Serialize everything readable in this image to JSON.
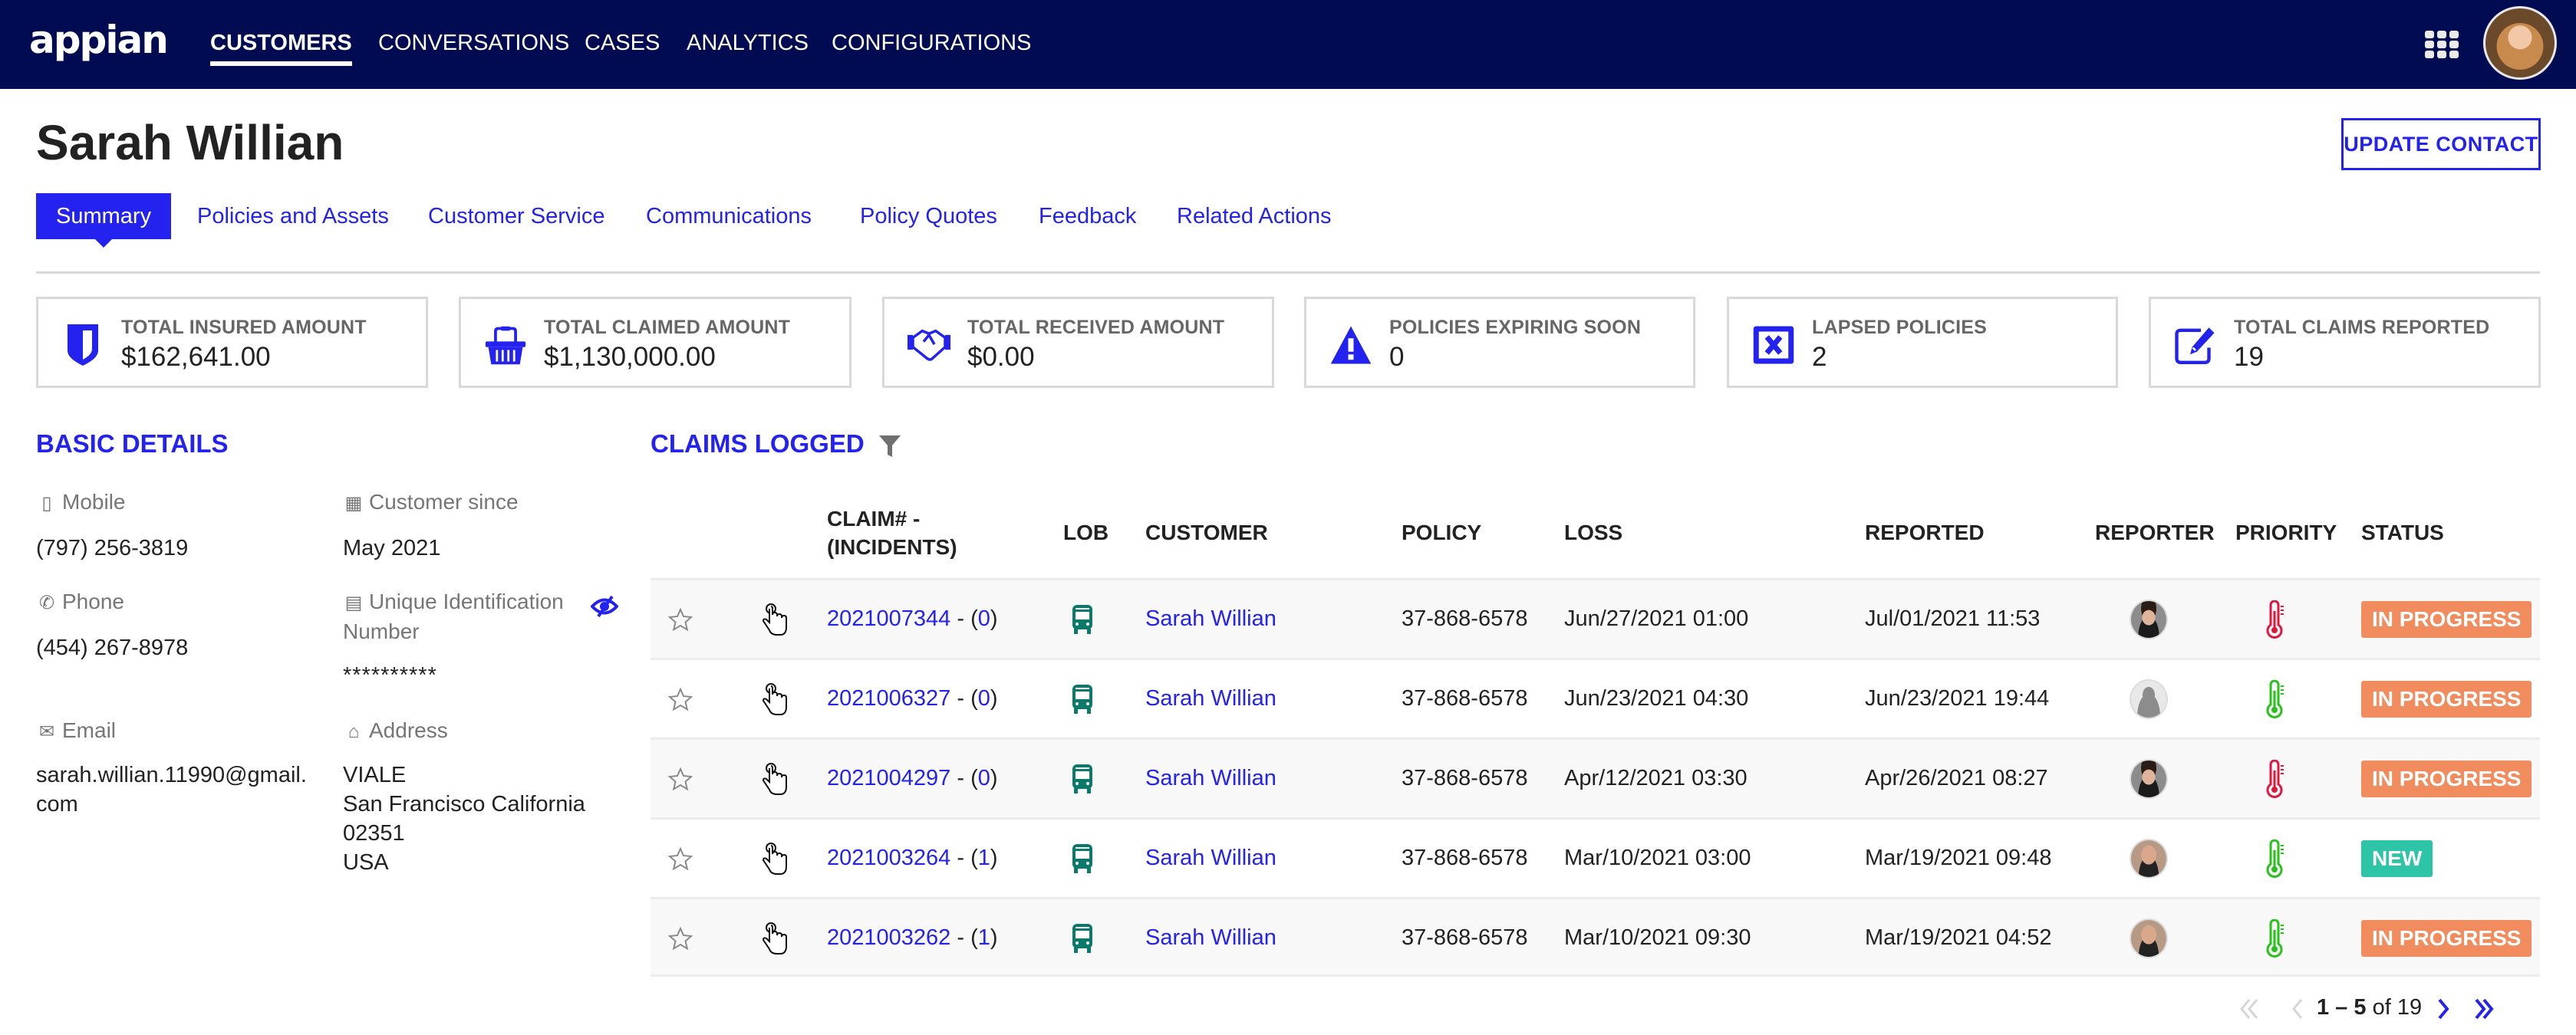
{
  "app": {
    "logo": "appian",
    "nav": [
      {
        "label": "CUSTOMERS",
        "active": true
      },
      {
        "label": "CONVERSATIONS",
        "active": false
      },
      {
        "label": "CASES",
        "active": false
      },
      {
        "label": "ANALYTICS",
        "active": false
      },
      {
        "label": "CONFIGURATIONS",
        "active": false
      }
    ],
    "apps_icon": "grid-icon",
    "user_avatar": "user-avatar"
  },
  "page": {
    "title": "Sarah Willian",
    "update_button": "UPDATE CONTACT",
    "tabs": [
      {
        "label": "Summary",
        "active": true
      },
      {
        "label": "Policies and Assets",
        "active": false
      },
      {
        "label": "Customer Service",
        "active": false
      },
      {
        "label": "Communications",
        "active": false
      },
      {
        "label": "Policy Quotes",
        "active": false
      },
      {
        "label": "Feedback",
        "active": false
      },
      {
        "label": "Related Actions",
        "active": false
      }
    ]
  },
  "kpis": [
    {
      "icon": "shield-icon",
      "label": "TOTAL INSURED AMOUNT",
      "value": "$162,641.00"
    },
    {
      "icon": "basket-icon",
      "label": "TOTAL CLAIMED AMOUNT",
      "value": "$1,130,000.00"
    },
    {
      "icon": "handshake-icon",
      "label": "TOTAL RECEIVED AMOUNT",
      "value": "$0.00"
    },
    {
      "icon": "warning-icon",
      "label": "POLICIES EXPIRING SOON",
      "value": "0"
    },
    {
      "icon": "lapsed-x-icon",
      "label": "LAPSED POLICIES",
      "value": "2"
    },
    {
      "icon": "edit-icon",
      "label": "TOTAL CLAIMS REPORTED",
      "value": "19"
    }
  ],
  "basic_details": {
    "title": "BASIC DETAILS",
    "mobile": {
      "label": "Mobile",
      "icon": "mobile-icon",
      "value": "(797) 256-3819"
    },
    "customer_since": {
      "label": "Customer since",
      "icon": "calendar-icon",
      "value": "May 2021"
    },
    "phone": {
      "label": "Phone",
      "icon": "phone-icon",
      "value": "(454) 267-8978"
    },
    "uid": {
      "label_line1": "Unique Identification",
      "label_line2": "Number",
      "icon": "id-card-icon",
      "value": "**********",
      "toggle_icon": "eye-slash-icon"
    },
    "email": {
      "label": "Email",
      "icon": "envelope-icon",
      "value_line1": "sarah.willian.11990@gmail.",
      "value_line2": "com"
    },
    "address": {
      "label": "Address",
      "icon": "home-icon",
      "lines": [
        "VIALE",
        "San Francisco California",
        "02351",
        "USA"
      ]
    }
  },
  "claims": {
    "title": "CLAIMS LOGGED",
    "filter_icon": "filter-icon",
    "columns": {
      "claim_line1": "CLAIM# -",
      "claim_line2": "(INCIDENTS)",
      "lob": "LOB",
      "customer": "CUSTOMER",
      "policy": "POLICY",
      "loss": "LOSS",
      "reported": "REPORTED",
      "reporter": "REPORTER",
      "priority": "PRIORITY",
      "status": "STATUS"
    },
    "rows": [
      {
        "claim": "2021007344",
        "incidents": "0",
        "lob": "bus-icon",
        "customer": "Sarah Willian",
        "policy": "37-868-6578",
        "loss": "Jun/27/2021 01:00",
        "reported": "Jul/01/2021 11:53",
        "reporter": "man-dark-hair",
        "priority": "high",
        "status": "IN PROGRESS"
      },
      {
        "claim": "2021006327",
        "incidents": "0",
        "lob": "bus-icon",
        "customer": "Sarah Willian",
        "policy": "37-868-6578",
        "loss": "Jun/23/2021 04:30",
        "reported": "Jun/23/2021 19:44",
        "reporter": "placeholder",
        "priority": "low",
        "status": "IN PROGRESS"
      },
      {
        "claim": "2021004297",
        "incidents": "0",
        "lob": "bus-icon",
        "customer": "Sarah Willian",
        "policy": "37-868-6578",
        "loss": "Apr/12/2021 03:30",
        "reported": "Apr/26/2021 08:27",
        "reporter": "man-dark-hair",
        "priority": "high",
        "status": "IN PROGRESS"
      },
      {
        "claim": "2021003264",
        "incidents": "1",
        "lob": "bus-icon",
        "customer": "Sarah Willian",
        "policy": "37-868-6578",
        "loss": "Mar/10/2021 03:00",
        "reported": "Mar/19/2021 09:48",
        "reporter": "man-bald",
        "priority": "low",
        "status": "NEW"
      },
      {
        "claim": "2021003262",
        "incidents": "1",
        "lob": "bus-icon",
        "customer": "Sarah Willian",
        "policy": "37-868-6578",
        "loss": "Mar/10/2021 09:30",
        "reported": "Mar/19/2021 04:52",
        "reporter": "man-bald",
        "priority": "low",
        "status": "IN PROGRESS"
      }
    ],
    "pagination": {
      "range": "1 – 5",
      "of_label": "of",
      "total": "19"
    }
  },
  "colors": {
    "header_bg": "#000b52",
    "accent": "#2322ee",
    "status_in_progress": "#f08c5e",
    "status_new": "#2ec4a7",
    "priority_high": "#e0173d",
    "priority_low": "#26c21a",
    "lob_icon": "#0c7a6a"
  }
}
